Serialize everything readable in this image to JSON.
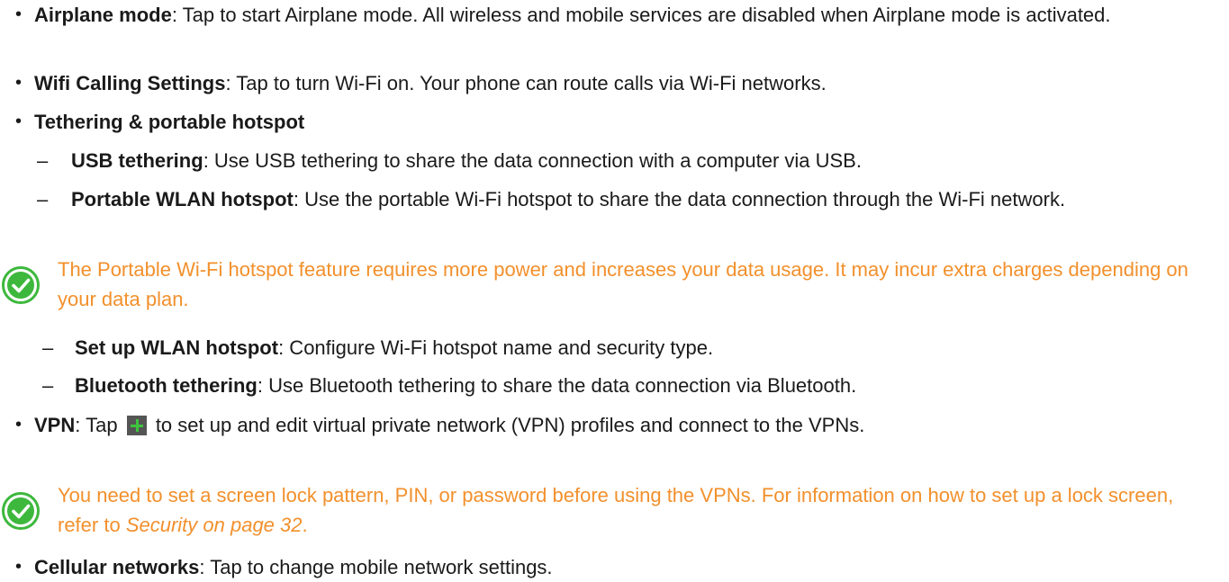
{
  "bullets": {
    "airplane": {
      "term": "Airplane mode",
      "text": ": Tap to start Airplane mode. All wireless and mobile services are disabled when Airplane mode is activated."
    },
    "wifi_calling": {
      "term": "Wifi Calling Settings",
      "text": ": Tap to turn Wi-Fi on. Your phone can route calls via Wi-Fi networks."
    },
    "tethering": {
      "term": "Tethering & portable hotspot"
    },
    "vpn": {
      "term": "VPN",
      "text_before": ": Tap",
      "text_after": "to set up and edit virtual private network (VPN) profiles and connect to the VPNs."
    },
    "cellular": {
      "term": "Cellular networks",
      "text": ": Tap to change mobile network settings."
    }
  },
  "sub_items": {
    "usb": {
      "dash": "–",
      "term": "USB tethering",
      "text": ": Use USB tethering to share the data connection with a computer via USB."
    },
    "portable": {
      "dash": "–",
      "term": "Portable WLAN hotspot",
      "text": ": Use the portable Wi-Fi hotspot to share the data connection through the Wi-Fi network."
    },
    "setup": {
      "dash": "–",
      "term": "Set up WLAN hotspot",
      "text": ": Configure Wi-Fi hotspot name and security type."
    },
    "bluetooth": {
      "dash": "–",
      "term": "Bluetooth tethering",
      "text": ": Use Bluetooth tethering to share the data connection via Bluetooth."
    }
  },
  "notes": {
    "hotspot": {
      "text": "The Portable Wi-Fi hotspot feature requires more power and increases your data usage. It may incur extra charges depending on your data plan."
    },
    "vpn": {
      "text": "You need to set a screen lock pattern, PIN, or password before using the VPNs. For information on how to set up a lock screen, refer to ",
      "link": "Security on page 32",
      "end": "."
    }
  },
  "bullet_symbol": "•",
  "icons": {
    "note": "check-circle-icon",
    "add": "plus-icon"
  },
  "colors": {
    "note_text": "#f2902c",
    "check_icon": "#3db83d",
    "plus_icon_bg": "#555555"
  }
}
